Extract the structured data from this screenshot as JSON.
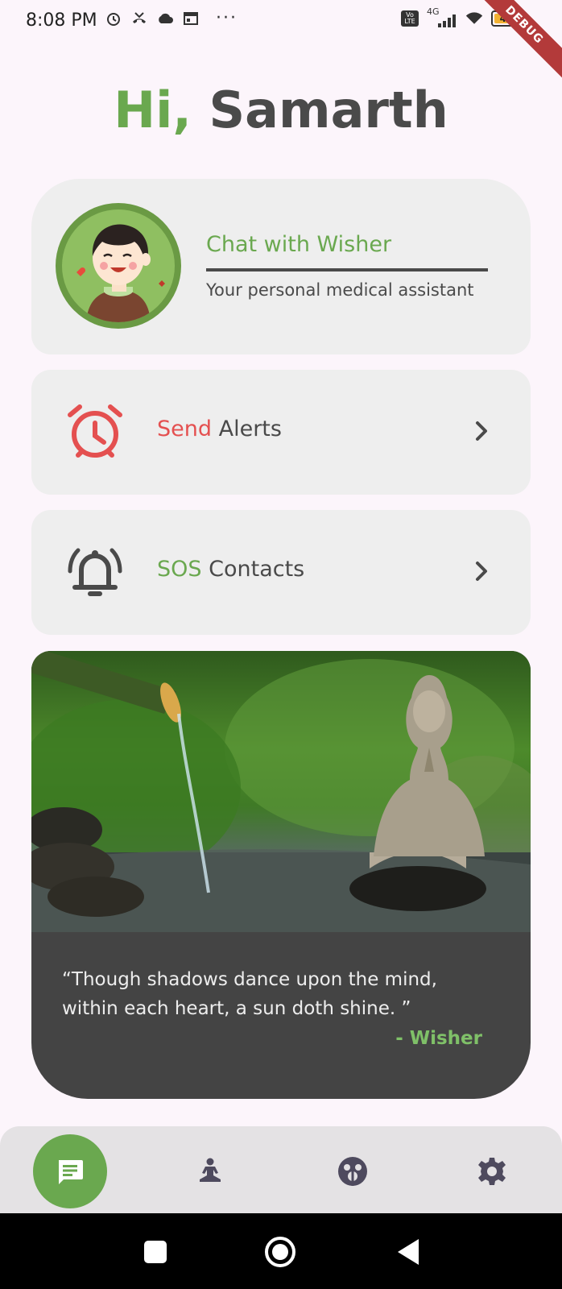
{
  "status_bar": {
    "time": "8:08 PM",
    "network": "4G",
    "volte": "Vo LTE",
    "battery": "49",
    "debug_banner": "DEBUG",
    "more": "···"
  },
  "greeting": {
    "hi": "Hi,",
    "name": "Samarth"
  },
  "chat_card": {
    "title": "Chat with Wisher",
    "subtitle": "Your personal medical assistant"
  },
  "alerts_card": {
    "accent": "Send",
    "rest": "Alerts"
  },
  "sos_card": {
    "accent": "SOS",
    "rest": "Contacts"
  },
  "quote": {
    "text": "“Though shadows dance upon the mind, within each heart, a sun doth shine. ”",
    "author": "- Wisher"
  },
  "bottom_nav": {
    "items": [
      {
        "icon": "chat-icon",
        "active": true
      },
      {
        "icon": "meditation-icon",
        "active": false
      },
      {
        "icon": "mood-icon",
        "active": false
      },
      {
        "icon": "settings-icon",
        "active": false
      }
    ]
  },
  "colors": {
    "accent_green": "#6aa84f",
    "accent_red": "#e45050",
    "text_dark": "#4a4a4a",
    "card_bg": "#eeeeee",
    "page_bg": "#fcf5fb",
    "quote_bg": "#444444"
  }
}
